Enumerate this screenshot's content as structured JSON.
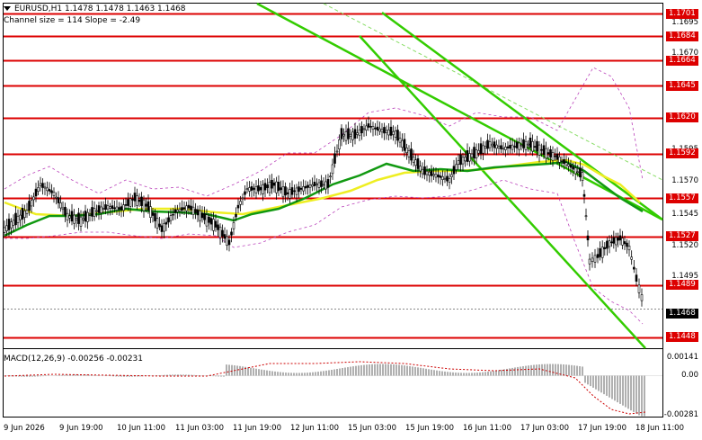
{
  "header": {
    "symbol_info": "EURUSD,H1  1.1478 1.1478 1.1463 1.1468",
    "channel_info": "Channel size = 114  Slope = -2.49"
  },
  "macd": {
    "label": "MACD(12,26,9) -0.00256 -0.00231",
    "scale_top": "0.00141",
    "scale_zero": "0.00",
    "scale_bottom": "-0.00281"
  },
  "price_scale": {
    "labels": [
      "1.1695",
      "1.1670",
      "1.1595",
      "1.1570",
      "1.1545",
      "1.1520",
      "1.1495"
    ],
    "levels": [
      "1.1701",
      "1.1684",
      "1.1664",
      "1.1645",
      "1.1620",
      "1.1592",
      "1.1557",
      "1.1527",
      "1.1489",
      "1.1448"
    ],
    "current_price": "1.1468"
  },
  "time_axis": {
    "labels": [
      "9 Jun 2026",
      "9 Jun 19:00",
      "10 Jun 11:00",
      "11 Jun 03:00",
      "11 Jun 19:00",
      "12 Jun 11:00",
      "15 Jun 03:00",
      "15 Jun 19:00",
      "16 Jun 11:00",
      "17 Jun 03:00",
      "17 Jun 19:00",
      "18 Jun 11:00"
    ]
  },
  "colors": {
    "level_line": "#dd0000",
    "channel": "#33cc00",
    "ma_fast": "#119911",
    "ma_slow": "#eeee22",
    "bollinger": "#bb44bb",
    "macd_signal": "#cc0000",
    "macd_hist": "#b0b0b0"
  },
  "chart_data": {
    "type": "candlestick",
    "symbol": "EURUSD",
    "timeframe": "H1",
    "last_bar": {
      "open": 1.1478,
      "high": 1.1478,
      "low": 1.1463,
      "close": 1.1468
    },
    "horizontal_levels": [
      1.1701,
      1.1684,
      1.1664,
      1.1645,
      1.162,
      1.1592,
      1.1557,
      1.1527,
      1.1489,
      1.1448
    ],
    "ylim": [
      1.144,
      1.1705
    ],
    "macd": {
      "fast": 12,
      "slow": 26,
      "signal": 9,
      "macd": -0.00256,
      "signal_value": -0.00231,
      "ylim": [
        -0.00281,
        0.00141
      ]
    }
  }
}
